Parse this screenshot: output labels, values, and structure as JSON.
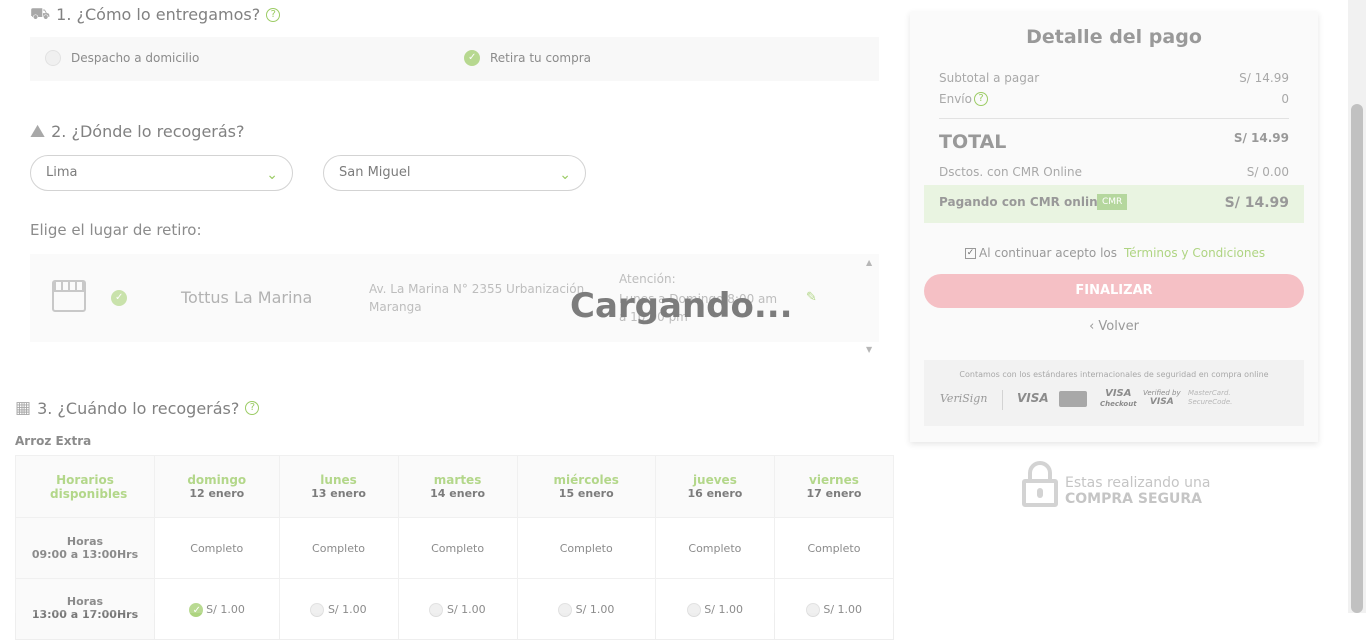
{
  "delivery": {
    "title": "1. ¿Cómo lo entregamos?",
    "option_home": "Despacho a domicilio",
    "option_pickup": "Retira tu compra"
  },
  "pickup": {
    "title": "2. ¿Dónde lo recogerás?",
    "region": "Lima",
    "district": "San Miguel",
    "choose_label": "Elige el lugar de retiro:",
    "store_name": "Tottus La Marina",
    "store_address": "Av. La Marina N° 2355 Urbanización Maranga",
    "store_hours_label": "Atención:",
    "store_hours": "Lunes a Domingo 8:00 am a 10:00 pm",
    "loading": "Cargando..."
  },
  "when": {
    "title": "3. ¿Cuándo lo recogerás?",
    "product": "Arroz Extra",
    "header_label": "Horarios disponibles",
    "days": [
      {
        "day": "domingo",
        "date": "12 enero"
      },
      {
        "day": "lunes",
        "date": "13 enero"
      },
      {
        "day": "martes",
        "date": "14 enero"
      },
      {
        "day": "miércoles",
        "date": "15 enero"
      },
      {
        "day": "jueves",
        "date": "16 enero"
      },
      {
        "day": "viernes",
        "date": "17 enero"
      }
    ],
    "slot1_label": "Horas",
    "slot1_time": "09:00 a 13:00Hrs",
    "slot1_value": "Completo",
    "slot2_label": "Horas",
    "slot2_time": "13:00 a 17:00Hrs",
    "slot2_price": "S/ 1.00"
  },
  "payment": {
    "title": "Detalle del pago",
    "subtotal_label": "Subtotal a pagar",
    "subtotal": "S/ 14.99",
    "shipping_label": "Envío",
    "shipping": "0",
    "total_label": "TOTAL",
    "total": "S/ 14.99",
    "discount_label": "Dsctos. con CMR Online",
    "discount": "S/ 0.00",
    "cmr_label": "Pagando con CMR online",
    "cmr_badge": "CMR",
    "cmr_total": "S/ 14.99",
    "terms_prefix": "Al continuar acepto los",
    "terms_link": "Términos y Condiciones",
    "finish": "FINALIZAR",
    "back": "Volver",
    "security_text": "Contamos con los estándares internacionales de seguridad en compra online",
    "brand_verisign": "VeriSign",
    "brand_visa": "VISA",
    "brand_visa_checkout_1": "VISA",
    "brand_visa_checkout_2": "Checkout",
    "brand_verified_1": "Verified by",
    "brand_verified_2": "VISA",
    "brand_mc_1": "MasterCard.",
    "brand_mc_2": "SecureCode.",
    "secure_1": "Estas realizando una",
    "secure_2": "COMPRA SEGURA"
  },
  "colors": {
    "accent": "#8bc34a",
    "finish": "#f4b6bb"
  }
}
